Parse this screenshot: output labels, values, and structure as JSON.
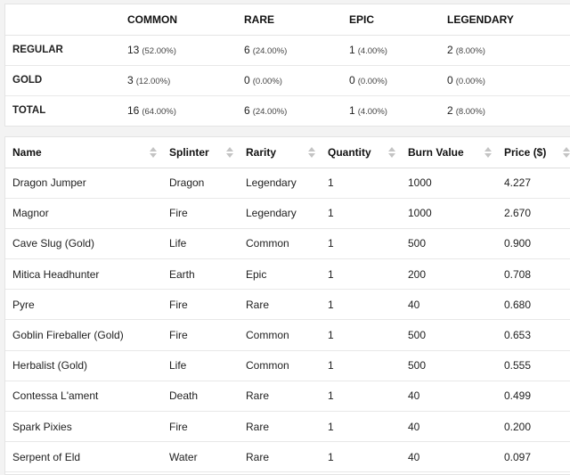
{
  "summary": {
    "headers": [
      "",
      "COMMON",
      "RARE",
      "EPIC",
      "LEGENDARY"
    ],
    "rows": [
      {
        "label": "REGULAR",
        "cells": [
          {
            "count": "13",
            "pct": "(52.00%)"
          },
          {
            "count": "6",
            "pct": "(24.00%)"
          },
          {
            "count": "1",
            "pct": "(4.00%)"
          },
          {
            "count": "2",
            "pct": "(8.00%)"
          }
        ]
      },
      {
        "label": "GOLD",
        "cells": [
          {
            "count": "3",
            "pct": "(12.00%)"
          },
          {
            "count": "0",
            "pct": "(0.00%)"
          },
          {
            "count": "0",
            "pct": "(0.00%)"
          },
          {
            "count": "0",
            "pct": "(0.00%)"
          }
        ]
      },
      {
        "label": "TOTAL",
        "cells": [
          {
            "count": "16",
            "pct": "(64.00%)"
          },
          {
            "count": "6",
            "pct": "(24.00%)"
          },
          {
            "count": "1",
            "pct": "(4.00%)"
          },
          {
            "count": "2",
            "pct": "(8.00%)"
          }
        ]
      }
    ]
  },
  "cards": {
    "columns": [
      "Name",
      "Splinter",
      "Rarity",
      "Quantity",
      "Burn Value",
      "Price ($)"
    ],
    "rows": [
      [
        "Dragon Jumper",
        "Dragon",
        "Legendary",
        "1",
        "1000",
        "4.227"
      ],
      [
        "Magnor",
        "Fire",
        "Legendary",
        "1",
        "1000",
        "2.670"
      ],
      [
        "Cave Slug (Gold)",
        "Life",
        "Common",
        "1",
        "500",
        "0.900"
      ],
      [
        "Mitica Headhunter",
        "Earth",
        "Epic",
        "1",
        "200",
        "0.708"
      ],
      [
        "Pyre",
        "Fire",
        "Rare",
        "1",
        "40",
        "0.680"
      ],
      [
        "Goblin Fireballer (Gold)",
        "Fire",
        "Common",
        "1",
        "500",
        "0.653"
      ],
      [
        "Herbalist (Gold)",
        "Life",
        "Common",
        "1",
        "500",
        "0.555"
      ],
      [
        "Contessa L'ament",
        "Death",
        "Rare",
        "1",
        "40",
        "0.499"
      ],
      [
        "Spark Pixies",
        "Fire",
        "Rare",
        "1",
        "40",
        "0.200"
      ],
      [
        "Serpent of Eld",
        "Water",
        "Rare",
        "1",
        "40",
        "0.097"
      ]
    ]
  },
  "icons": {
    "sort": "sort-arrows-icon"
  },
  "colors": {
    "background": "#f3f3f3",
    "panel": "#ffffff",
    "border": "#e4e4e4",
    "sort_icon": "#c4c4c4"
  }
}
